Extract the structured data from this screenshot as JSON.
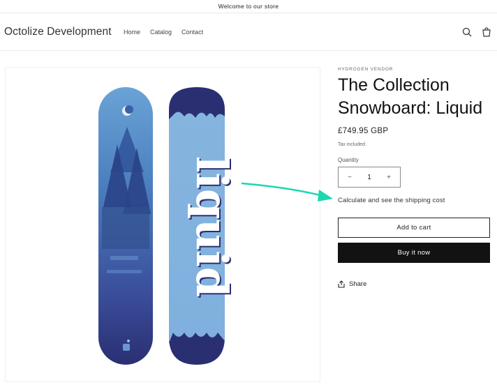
{
  "announcement": {
    "text": "Welcome to our store"
  },
  "header": {
    "brand": "Octolize Development",
    "nav": [
      {
        "label": "Home"
      },
      {
        "label": "Catalog"
      },
      {
        "label": "Contact"
      }
    ],
    "icons": [
      "search-icon",
      "cart-icon"
    ]
  },
  "product": {
    "vendor": "HYDROGEN VENDOR",
    "title": "The Collection Snowboard: Liquid",
    "price": "£749.95 GBP",
    "tax_note": "Tax included.",
    "quantity_label": "Quantity",
    "quantity_value": "1",
    "decrease_symbol": "−",
    "increase_symbol": "+",
    "shipping_link": "Calculate and see the shipping cost",
    "add_to_cart": "Add to cart",
    "buy_now": "Buy it now",
    "share": "Share"
  },
  "colors": {
    "accent_arrow": "#1ed6b0",
    "board_blue": "#4b7fbf",
    "board_navy": "#2a2f72",
    "button_dark": "#121212"
  }
}
